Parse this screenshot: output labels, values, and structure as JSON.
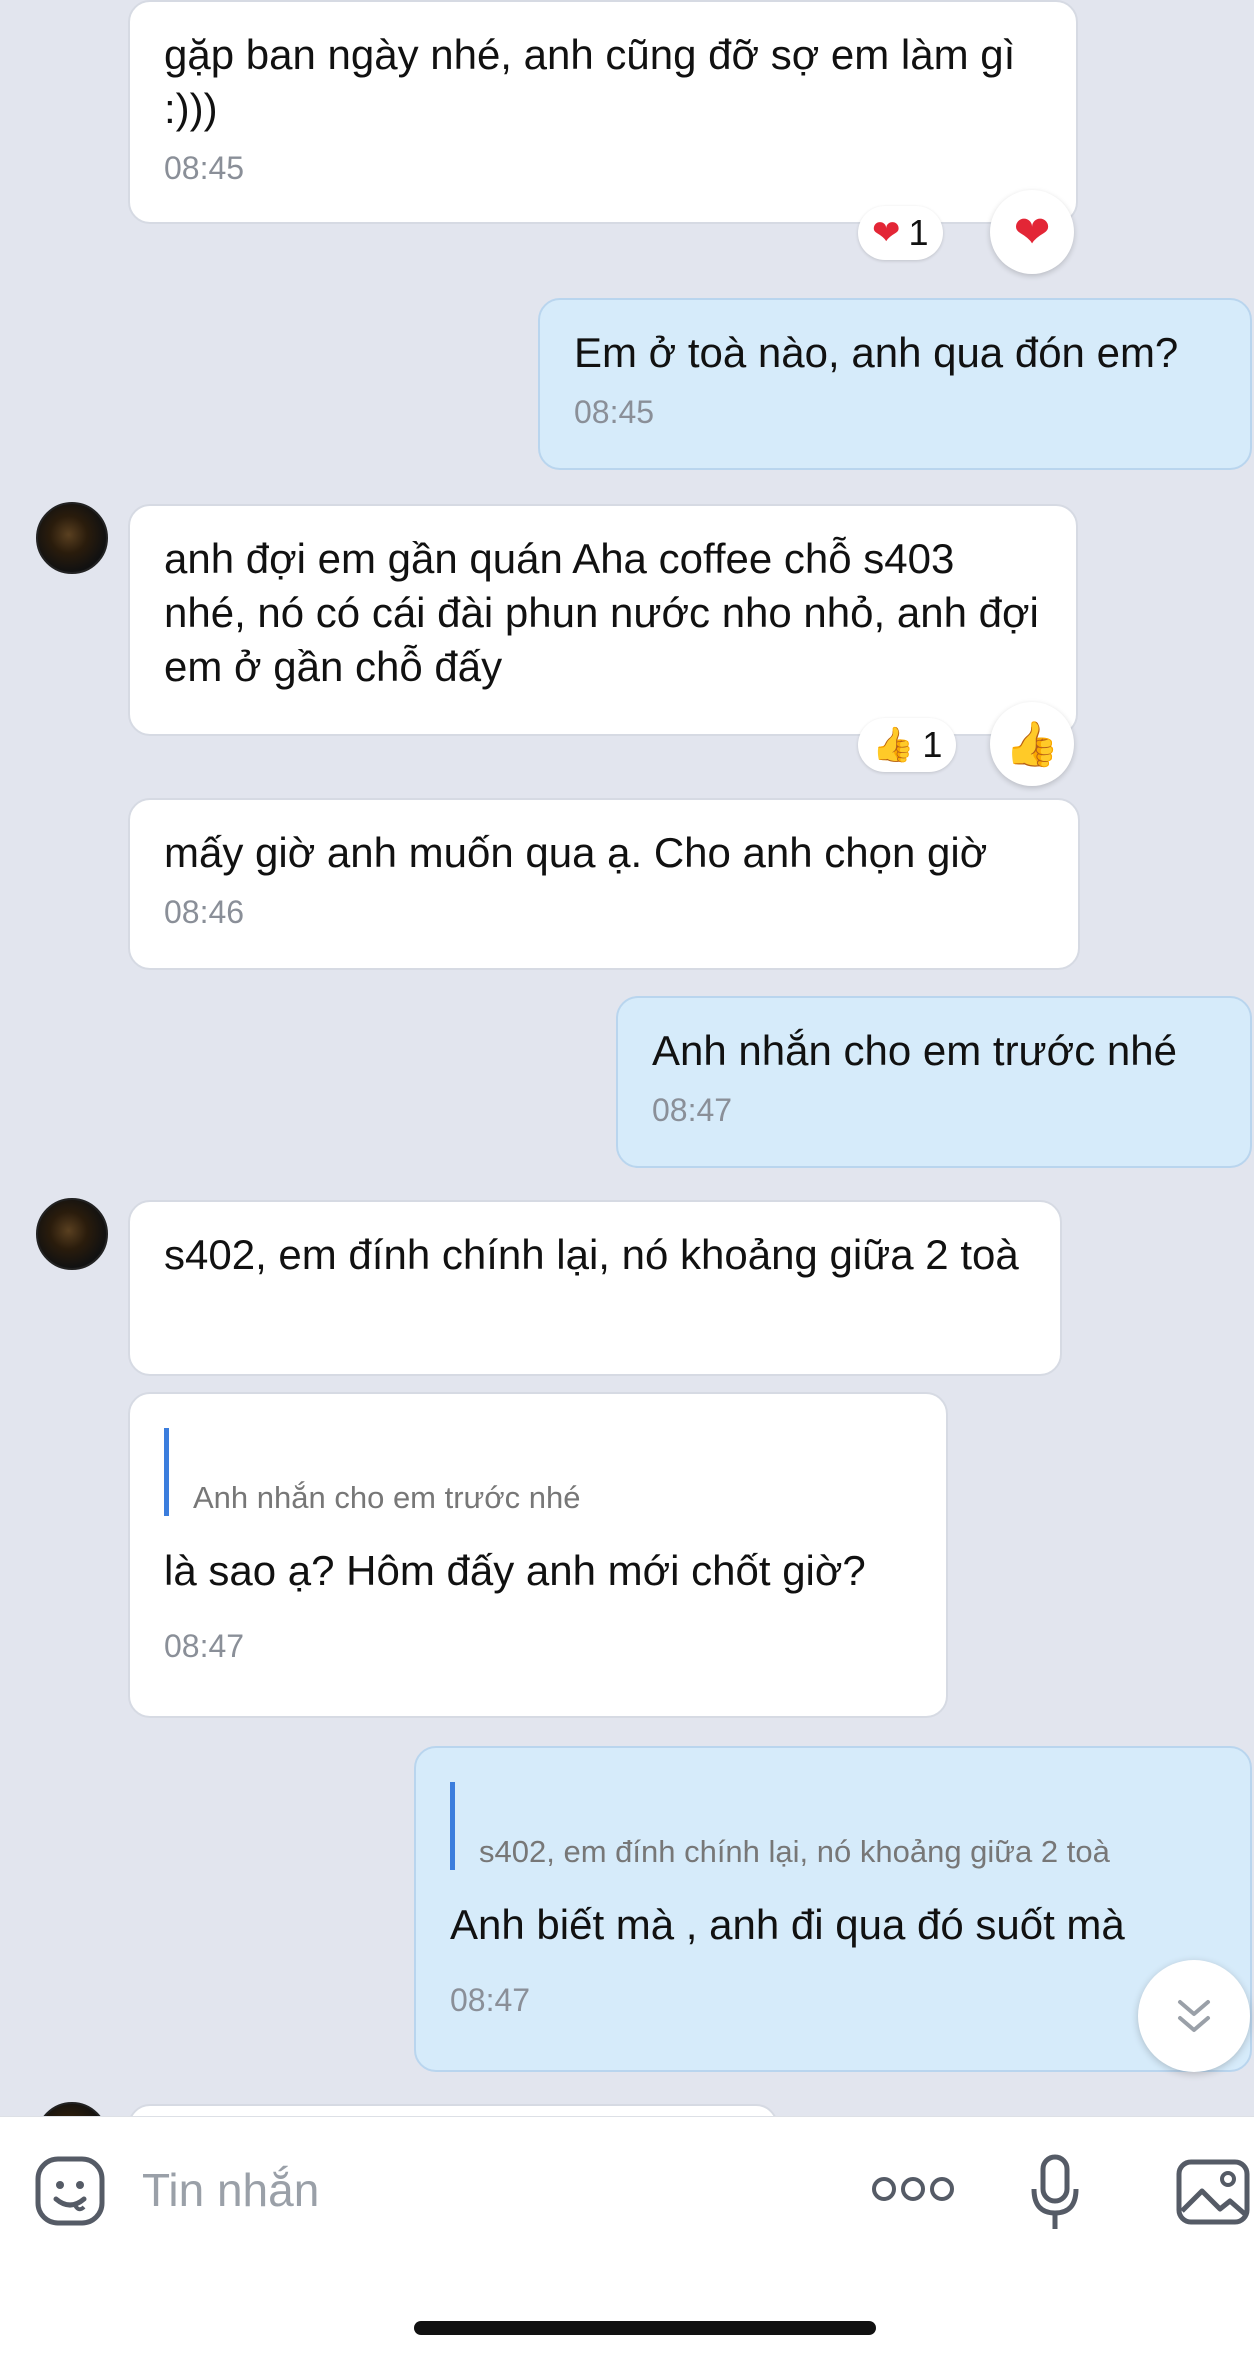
{
  "messages": [
    {
      "side": "in",
      "text": "gặp ban ngày nhé, anh cũng đỡ sợ em làm gì :)))",
      "time": "08:45",
      "reaction": {
        "icon": "heart-icon",
        "glyph": "❤",
        "count": "1"
      }
    },
    {
      "side": "out",
      "text": "Em ở toà nào, anh qua đón em?",
      "time": "08:45"
    },
    {
      "side": "in",
      "text": "anh đợi em gần quán Aha coffee chỗ s403 nhé, nó có cái đài phun nước nho nhỏ, anh đợi em ở gần chỗ đấy",
      "reaction": {
        "icon": "thumbs-up-icon",
        "glyph": "👍",
        "count": "1"
      }
    },
    {
      "side": "in",
      "text": "mấy giờ anh muốn qua ạ. Cho anh chọn giờ",
      "time": "08:46"
    },
    {
      "side": "out",
      "text": "Anh nhắn cho em trước nhé",
      "time": "08:47"
    },
    {
      "side": "in",
      "text": "s402, em đính chính lại, nó khoảng giữa 2 toà"
    },
    {
      "side": "in",
      "quote": {
        "author": "",
        "text": "Anh nhắn cho em trước nhé"
      },
      "text": "là sao ạ? Hôm đấy anh mới chốt giờ?",
      "time": "08:47"
    },
    {
      "side": "out",
      "quote": {
        "author": "",
        "text": "s402, em đính chính lại, nó khoảng giữa 2 toà"
      },
      "text": "Anh biết mà , anh đi qua đó suốt mà",
      "time": "08:47"
    }
  ],
  "composer": {
    "placeholder": "Tin nhắn",
    "icons": [
      "emoji-icon",
      "more-icon",
      "microphone-icon",
      "image-icon"
    ]
  },
  "colors": {
    "background": "#e2e5ee",
    "incoming_bubble": "#ffffff",
    "outgoing_bubble": "#d6ebfa",
    "quote_bar": "#3b7ddd"
  }
}
